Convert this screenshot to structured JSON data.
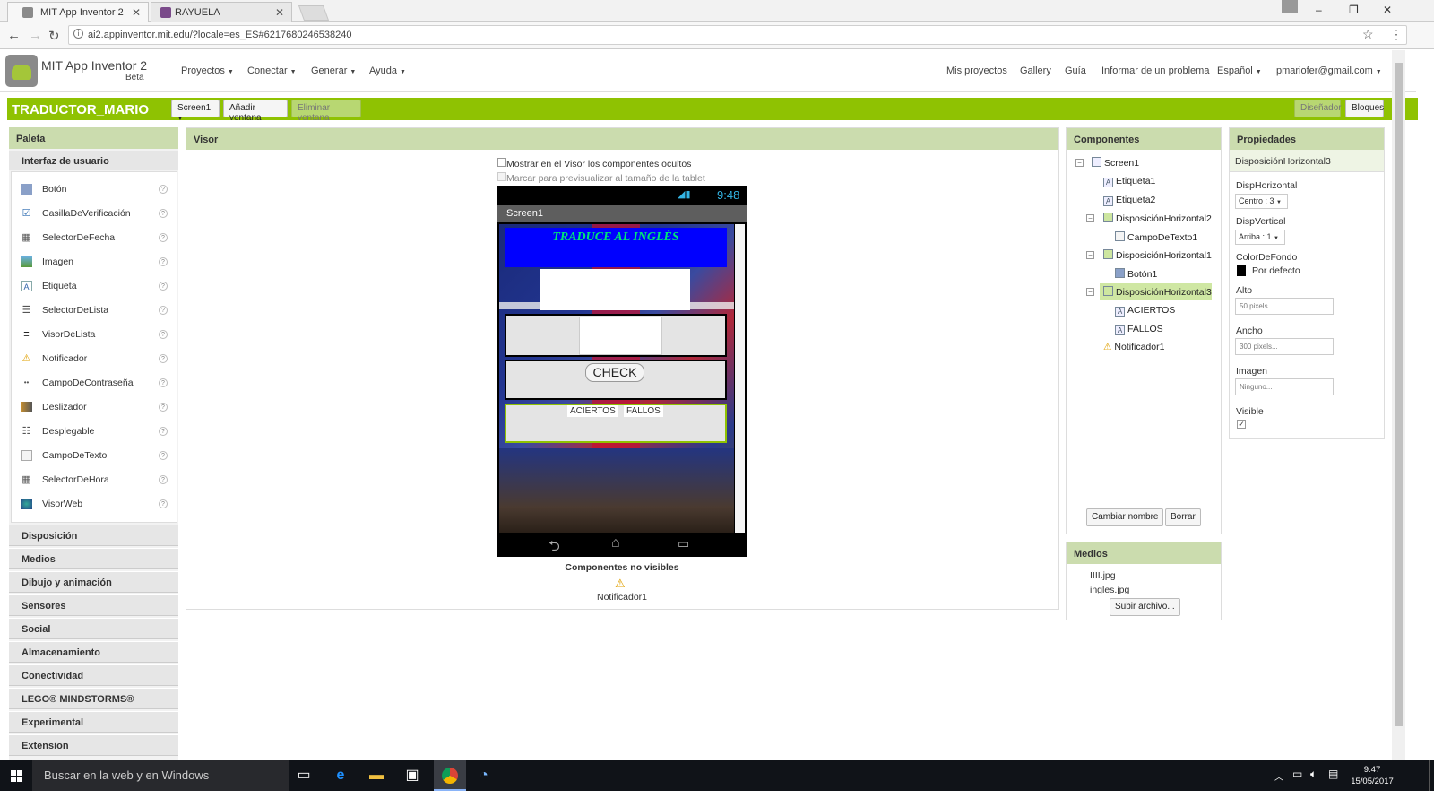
{
  "browser": {
    "tabs": [
      {
        "title": "MIT App Inventor 2",
        "active": true
      },
      {
        "title": "RAYUELA",
        "active": false
      }
    ],
    "url": "ai2.appinventor.mit.edu/?locale=es_ES#6217680246538240",
    "close_glyph": "✕"
  },
  "app": {
    "brand": "MIT App Inventor 2",
    "beta": "Beta",
    "menus": [
      "Proyectos",
      "Conectar",
      "Generar",
      "Ayuda"
    ],
    "right_links": [
      "Mis proyectos",
      "Gallery",
      "Guía",
      "Informar de un problema"
    ],
    "language": "Español",
    "user": "pmariofer@gmail.com"
  },
  "toolbar": {
    "project": "TRADUCTOR_MARIO",
    "screen_select": "Screen1",
    "add_screen": "Añadir ventana",
    "remove_screen": "Eliminar ventana",
    "designer": "Diseñador",
    "blocks": "Bloques"
  },
  "palette": {
    "title": "Paleta",
    "category": "Interfaz de usuario",
    "items": [
      {
        "label": "Botón",
        "icon": "button-icon"
      },
      {
        "label": "CasillaDeVerificación",
        "icon": "checkbox-icon"
      },
      {
        "label": "SelectorDeFecha",
        "icon": "datepicker-icon"
      },
      {
        "label": "Imagen",
        "icon": "image-icon"
      },
      {
        "label": "Etiqueta",
        "icon": "label-icon"
      },
      {
        "label": "SelectorDeLista",
        "icon": "listpicker-icon"
      },
      {
        "label": "VisorDeLista",
        "icon": "listview-icon"
      },
      {
        "label": "Notificador",
        "icon": "notifier-icon"
      },
      {
        "label": "CampoDeContraseña",
        "icon": "password-icon"
      },
      {
        "label": "Deslizador",
        "icon": "slider-icon"
      },
      {
        "label": "Desplegable",
        "icon": "spinner-icon"
      },
      {
        "label": "CampoDeTexto",
        "icon": "textbox-icon"
      },
      {
        "label": "SelectorDeHora",
        "icon": "timepicker-icon"
      },
      {
        "label": "VisorWeb",
        "icon": "webviewer-icon"
      }
    ],
    "help_glyph": "?",
    "drawers": [
      "Disposición",
      "Medios",
      "Dibujo y animación",
      "Sensores",
      "Social",
      "Almacenamiento",
      "Conectividad",
      "LEGO® MINDSTORMS®",
      "Experimental",
      "Extension"
    ]
  },
  "viewer": {
    "title": "Visor",
    "show_hidden": "Mostrar en el Visor los componentes ocultos",
    "tablet_preview": "Marcar para previsualizar al tamaño de la tablet",
    "time": "9:48",
    "screen_title": "Screen1",
    "heading": "TRADUCE AL INGLÉS",
    "check_button": "CHECK",
    "aciertos": "ACIERTOS",
    "fallos": "FALLOS",
    "nonvisible_title": "Componentes no visibles",
    "nonvisible_item": "Notificador1"
  },
  "components": {
    "title": "Componentes",
    "tree": [
      {
        "label": "Screen1",
        "level": 0
      },
      {
        "label": "Etiqueta1",
        "level": 1
      },
      {
        "label": "Etiqueta2",
        "level": 1
      },
      {
        "label": "DisposiciónHorizontal2",
        "level": 1
      },
      {
        "label": "CampoDeTexto1",
        "level": 2
      },
      {
        "label": "DisposiciónHorizontal1",
        "level": 1
      },
      {
        "label": "Botón1",
        "level": 2
      },
      {
        "label": "DisposiciónHorizontal3",
        "level": 1,
        "selected": true
      },
      {
        "label": "ACIERTOS",
        "level": 2
      },
      {
        "label": "FALLOS",
        "level": 2
      },
      {
        "label": "Notificador1",
        "level": 1
      }
    ],
    "rename": "Cambiar nombre",
    "delete": "Borrar"
  },
  "media": {
    "title": "Medios",
    "files": [
      "IIII.jpg",
      "ingles.jpg"
    ],
    "upload": "Subir archivo..."
  },
  "properties": {
    "title": "Propiedades",
    "component": "DisposiciónHorizontal3",
    "horizontal_label": "DispHorizontal",
    "horizontal_value": "Centro : 3",
    "vertical_label": "DispVertical",
    "vertical_value": "Arriba : 1",
    "bgcolor_label": "ColorDeFondo",
    "bgcolor_value": "Por defecto",
    "height_label": "Alto",
    "height_value": "50 pixels...",
    "width_label": "Ancho",
    "width_value": "300 pixels...",
    "image_label": "Imagen",
    "image_value": "Ninguno...",
    "visible_label": "Visible",
    "visible_checked": true
  },
  "taskbar": {
    "search": "Buscar en la web y en Windows",
    "time": "9:47",
    "date": "15/05/2017"
  },
  "colors": {
    "accent_green": "#8fc202",
    "panel_header": "#cbdcae",
    "phone_heading_bg": "#0000ff",
    "phone_heading_text": "#00e676"
  }
}
